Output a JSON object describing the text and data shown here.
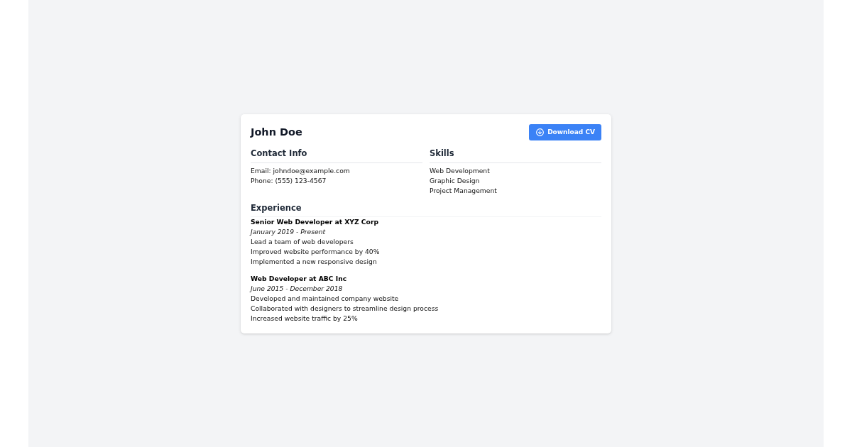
{
  "name": "John Doe",
  "download_button": {
    "label": "Download CV"
  },
  "contact_info": {
    "heading": "Contact Info",
    "lines": [
      "Email: johndoe@example.com",
      "Phone: (555) 123-4567"
    ]
  },
  "skills": {
    "heading": "Skills",
    "items": [
      "Web Development",
      "Graphic Design",
      "Project Management"
    ]
  },
  "experience": {
    "heading": "Experience",
    "entries": [
      {
        "title": "Senior Web Developer at XYZ Corp",
        "dates": "January 2019 - Present",
        "points": [
          "Lead a team of web developers",
          "Improved website performance by 40%",
          "Implemented a new responsive design"
        ]
      },
      {
        "title": "Web Developer at ABC Inc",
        "dates": "June 2015 - December 2018",
        "points": [
          "Developed and maintained company website",
          "Collaborated with designers to streamline design process",
          "Increased website traffic by 25%"
        ]
      }
    ]
  }
}
